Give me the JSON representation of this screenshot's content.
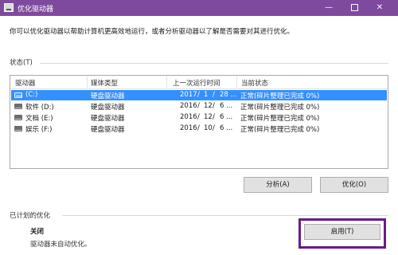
{
  "window": {
    "title": "优化驱动器",
    "minimize": "—",
    "close": "✕"
  },
  "intro": "你可以优化驱动器以帮助计算机更高效地运行，或者分析驱动器以了解是否需要对其进行优化。",
  "status": {
    "label": "状态(T)",
    "columns": [
      "驱动器",
      "媒体类型",
      "上一次运行时间",
      "当前状态"
    ],
    "drives": [
      {
        "name": "(C:)",
        "media": "硬盘驱动器",
        "y": "2017",
        "m": "1",
        "d": "28 ...",
        "status": "正常(碎片整理已完成 0%)",
        "icon": "windows-drive-icon",
        "selected": true
      },
      {
        "name": "软件 (D:)",
        "media": "硬盘驱动器",
        "y": "2016",
        "m": "12",
        "d": "6 ...",
        "status": "正常(碎片整理已完成 0%)",
        "icon": "hard-drive-icon",
        "selected": false
      },
      {
        "name": "文档 (E:)",
        "media": "硬盘驱动器",
        "y": "2016",
        "m": "12",
        "d": "6 ...",
        "status": "正常(碎片整理已完成 0%)",
        "icon": "hard-drive-icon",
        "selected": false
      },
      {
        "name": "娱乐 (F:)",
        "media": "硬盘驱动器",
        "y": "2016",
        "m": "10",
        "d": "6 ...",
        "status": "正常(碎片整理已完成 0%)",
        "icon": "hard-drive-icon",
        "selected": false
      }
    ]
  },
  "actions": {
    "analyze": "分析(A)",
    "optimize": "优化(O)"
  },
  "scheduled": {
    "label": "已计划的优化",
    "state": "关闭",
    "description": "驱动器未自动优化。",
    "enable": "启用(T)"
  },
  "colors": {
    "titlebar": "#7e4a9e",
    "selection": "#3390ff",
    "highlight_box": "#6a1b8a"
  }
}
